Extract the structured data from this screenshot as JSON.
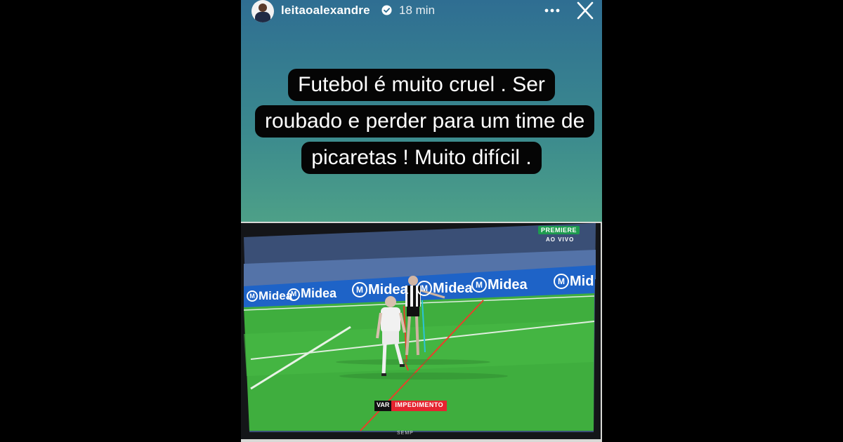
{
  "story": {
    "username": "leitaoalexandre",
    "time": "18 min",
    "caption_lines": [
      "Futebol é muito cruel . Ser",
      "roubado e perder para um time de",
      "picaretas ! Muito difícil ."
    ]
  },
  "icons": {
    "verified": "verified-check-icon",
    "more": "more-options-icon",
    "close": "close-icon"
  },
  "tv": {
    "channel": "PREMIERE",
    "live_label": "AO VIVO",
    "ad_board": [
      "Midea",
      "Midea",
      "Midea",
      "Midea",
      "Midea",
      "Mid"
    ],
    "var_label": "VAR",
    "call_label": "IMPEDIMENTO",
    "tv_brand": "SEMP"
  },
  "colors": {
    "background": "#000000",
    "story_gradient_top": "#2f6e92",
    "story_gradient_bottom": "#5aa97f",
    "caption_bg": "#050505",
    "verified": "#3897f0",
    "pitch_green": "#3fb33f",
    "ad_board": "#1e63c7",
    "var_red": "#e52430",
    "offside_line": "#e8402a",
    "offside_line_2": "#2bc4d8"
  }
}
